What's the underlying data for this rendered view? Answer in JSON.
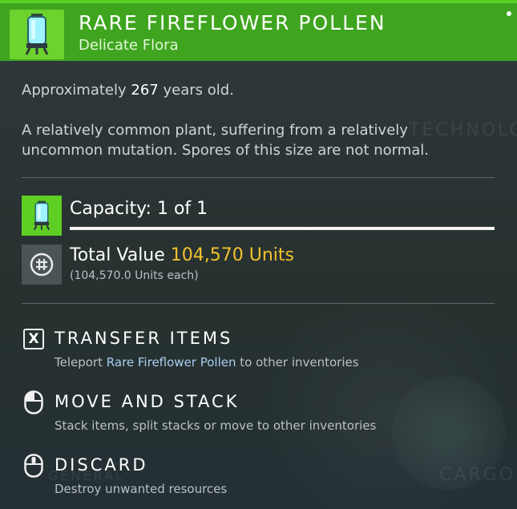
{
  "header": {
    "title": "RARE FIREFLOWER POLLEN",
    "subtitle": "Delicate Flora",
    "item_icon": "fireflower-pollen-canister-icon"
  },
  "info": {
    "age_prefix": "Approximately",
    "age_value": "267",
    "age_suffix": "years old.",
    "description": "A relatively common plant, suffering from a relatively uncommon mutation. Spores of this size are not normal."
  },
  "capacity": {
    "label": "Capacity: 1 of 1",
    "icon": "fireflower-pollen-canister-icon",
    "fill_fraction": 1.0
  },
  "value": {
    "label": "Total Value",
    "amount": "104,570 Units",
    "each": "(104,570.0 Units each)",
    "icon": "units-currency-icon"
  },
  "actions": [
    {
      "name": "TRANSFER ITEMS",
      "key": "X",
      "hint_prefix": "Teleport",
      "hint_highlight": "Rare Fireflower Pollen",
      "hint_suffix": "to other inventories",
      "icon": "x-key-icon"
    },
    {
      "name": "MOVE AND STACK",
      "hint": "Stack items, split stacks or move to other inventories",
      "icon": "mouse-left-click-icon"
    },
    {
      "name": "DISCARD",
      "hint": "Destroy unwanted resources",
      "icon": "mouse-middle-click-icon"
    }
  ],
  "background_text": {
    "technology": "TECHNOLO",
    "cargo": "CARGO",
    "general": "GENERAL"
  },
  "colors": {
    "header_green": "#3fa51f",
    "icon_green": "#6bd22e",
    "units_gold": "#f2c12e",
    "highlight_blue": "#a9cdf0"
  }
}
